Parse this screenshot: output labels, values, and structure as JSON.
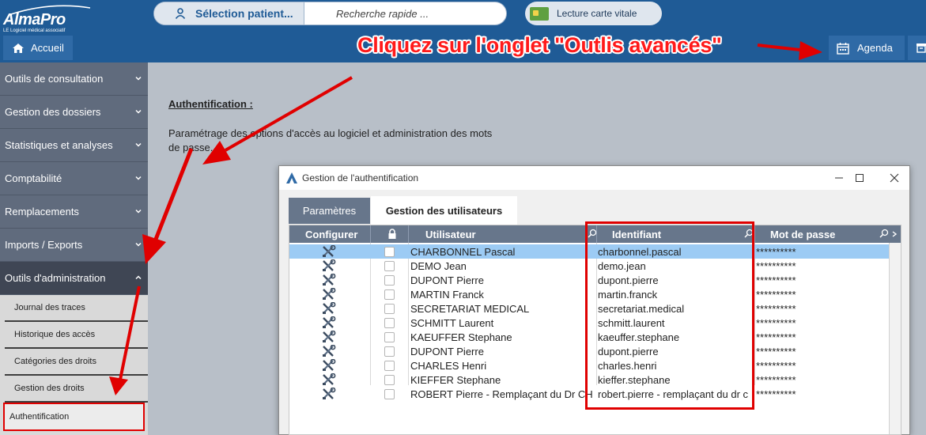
{
  "app": {
    "logo_name": "AlmaPro",
    "logo_tagline": "LE Logiciel médical associatif"
  },
  "header": {
    "patient_select_label": "Sélection patient...",
    "quick_search_placeholder": "Recherche rapide ...",
    "vitale_label": "Lecture carte vitale",
    "home_label": "Accueil",
    "agenda_label": "Agenda"
  },
  "annotation": {
    "instruction": "Cliquez sur l'onglet \"Outlis avancés\"",
    "highlight_color": "#e00000",
    "arrow_color": "#e00000"
  },
  "sidebar": {
    "items": [
      {
        "label": "Outils de consultation"
      },
      {
        "label": "Gestion des dossiers"
      },
      {
        "label": "Statistiques et analyses"
      },
      {
        "label": "Comptabilité"
      },
      {
        "label": "Remplacements"
      },
      {
        "label": "Imports / Exports"
      },
      {
        "label": "Outils d'administration"
      }
    ],
    "subitems": [
      {
        "label": "Journal des traces"
      },
      {
        "label": "Historique des accès"
      },
      {
        "label": "Catégories des droits"
      },
      {
        "label": "Gestion des droits"
      },
      {
        "label": "Authentification"
      }
    ]
  },
  "content": {
    "title": "Authentification :",
    "description": "Paramétrage des options d'accès au logiciel et administration des mots de passe."
  },
  "dialog": {
    "title": "Gestion de l'authentification",
    "tabs": [
      {
        "label": "Paramètres"
      },
      {
        "label": "Gestion des utilisateurs"
      }
    ],
    "columns": {
      "configure": "Configurer",
      "user": "Utilisateur",
      "identifier": "Identifiant",
      "password": "Mot de passe"
    },
    "rows": [
      {
        "user": "CHARBONNEL Pascal",
        "identifier": "charbonnel.pascal",
        "password": "**********"
      },
      {
        "user": "DEMO Jean",
        "identifier": "demo.jean",
        "password": "**********"
      },
      {
        "user": "DUPONT Pierre",
        "identifier": "dupont.pierre",
        "password": "**********"
      },
      {
        "user": "MARTIN Franck",
        "identifier": "martin.franck",
        "password": "**********"
      },
      {
        "user": "SECRETARIAT MEDICAL",
        "identifier": "secretariat.medical",
        "password": "**********"
      },
      {
        "user": "SCHMITT Laurent",
        "identifier": "schmitt.laurent",
        "password": "**********"
      },
      {
        "user": "KAEUFFER Stephane",
        "identifier": "kaeuffer.stephane",
        "password": "**********"
      },
      {
        "user": "DUPONT Pierre",
        "identifier": "dupont.pierre",
        "password": "**********"
      },
      {
        "user": "CHARLES Henri",
        "identifier": "charles.henri",
        "password": "**********"
      },
      {
        "user": "KIEFFER Stephane",
        "identifier": "kieffer.stephane",
        "password": "**********"
      },
      {
        "user": "ROBERT Pierre - Remplaçant du Dr CHA",
        "identifier": "robert.pierre - remplaçant du dr c",
        "password": "**********"
      }
    ]
  }
}
